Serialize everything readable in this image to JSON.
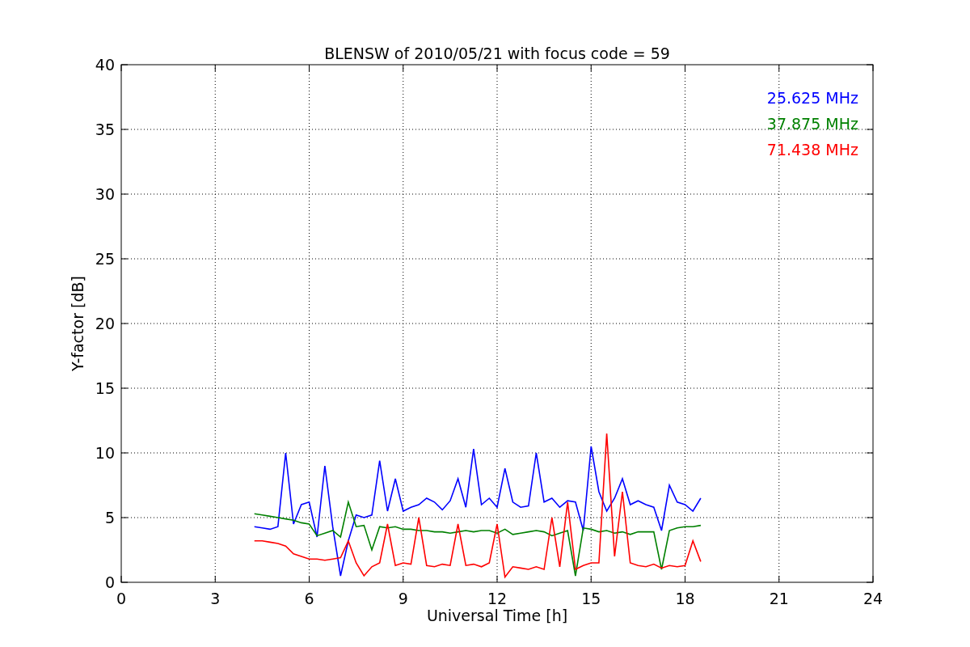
{
  "figure": {
    "chart_data": {
      "type": "line",
      "title": "BLENSW of 2010/05/21 with focus code = 59",
      "xlabel": "Universal Time [h]",
      "ylabel": "Y-factor [dB]",
      "x": [
        4.25,
        4.5,
        4.75,
        5.0,
        5.25,
        5.5,
        5.75,
        6.0,
        6.25,
        6.5,
        6.75,
        7.0,
        7.25,
        7.5,
        7.75,
        8.0,
        8.25,
        8.5,
        8.75,
        9.0,
        9.25,
        9.5,
        9.75,
        10.0,
        10.25,
        10.5,
        10.75,
        11.0,
        11.25,
        11.5,
        11.75,
        12.0,
        12.25,
        12.5,
        12.75,
        13.0,
        13.25,
        13.5,
        13.75,
        14.0,
        14.25,
        14.5,
        14.75,
        15.0,
        15.25,
        15.5,
        15.75,
        16.0,
        16.25,
        16.5,
        16.75,
        17.0,
        17.25,
        17.5,
        17.75,
        18.0,
        18.25,
        18.5
      ],
      "series": [
        {
          "name": "25.625 MHz",
          "color": "#0000ff",
          "values": [
            4.3,
            4.2,
            4.1,
            4.3,
            10.0,
            4.5,
            6.0,
            6.2,
            3.5,
            9.0,
            4.3,
            0.5,
            3.2,
            5.2,
            5.0,
            5.2,
            9.4,
            5.5,
            8.0,
            5.5,
            5.8,
            6.0,
            6.5,
            6.2,
            5.6,
            6.3,
            8.0,
            5.8,
            10.3,
            6.0,
            6.5,
            5.8,
            8.8,
            6.2,
            5.8,
            5.9,
            10.0,
            6.2,
            6.5,
            5.8,
            6.3,
            6.2,
            4.0,
            10.5,
            7.0,
            5.5,
            6.5,
            8.0,
            6.0,
            6.3,
            6.0,
            5.8,
            4.0,
            7.5,
            6.2,
            6.0,
            5.5,
            6.5
          ]
        },
        {
          "name": "37.875 MHz",
          "color": "#008000",
          "values": [
            5.3,
            5.2,
            5.1,
            5.0,
            4.9,
            4.8,
            4.6,
            4.5,
            3.6,
            3.8,
            4.0,
            3.5,
            6.2,
            4.3,
            4.4,
            2.5,
            4.3,
            4.2,
            4.3,
            4.1,
            4.1,
            4.0,
            4.0,
            3.9,
            3.9,
            3.8,
            3.9,
            4.0,
            3.9,
            4.0,
            4.0,
            3.8,
            4.1,
            3.7,
            3.8,
            3.9,
            4.0,
            3.9,
            3.6,
            3.8,
            4.0,
            0.5,
            4.2,
            4.1,
            3.9,
            4.0,
            3.8,
            3.9,
            3.7,
            3.9,
            3.9,
            3.9,
            1.0,
            4.0,
            4.2,
            4.3,
            4.3,
            4.4
          ]
        },
        {
          "name": "71.438 MHz",
          "color": "#ff0000",
          "values": [
            3.2,
            3.2,
            3.1,
            3.0,
            2.8,
            2.2,
            2.0,
            1.8,
            1.8,
            1.7,
            1.8,
            1.9,
            3.2,
            1.5,
            0.5,
            1.2,
            1.5,
            4.5,
            1.3,
            1.5,
            1.4,
            5.0,
            1.3,
            1.2,
            1.4,
            1.3,
            4.5,
            1.3,
            1.4,
            1.2,
            1.5,
            4.5,
            0.4,
            1.2,
            1.1,
            1.0,
            1.2,
            1.0,
            5.0,
            1.2,
            6.2,
            1.0,
            1.3,
            1.5,
            1.5,
            11.5,
            2.0,
            7.0,
            1.5,
            1.3,
            1.2,
            1.4,
            1.1,
            1.3,
            1.2,
            1.3,
            3.2,
            1.6
          ]
        }
      ],
      "xlim": [
        0,
        24
      ],
      "ylim": [
        0,
        40
      ],
      "grid": true,
      "xticks": [
        0,
        3,
        6,
        9,
        12,
        15,
        18,
        21,
        24
      ],
      "yticks": [
        0,
        5,
        10,
        15,
        20,
        25,
        30,
        35,
        40
      ]
    }
  }
}
